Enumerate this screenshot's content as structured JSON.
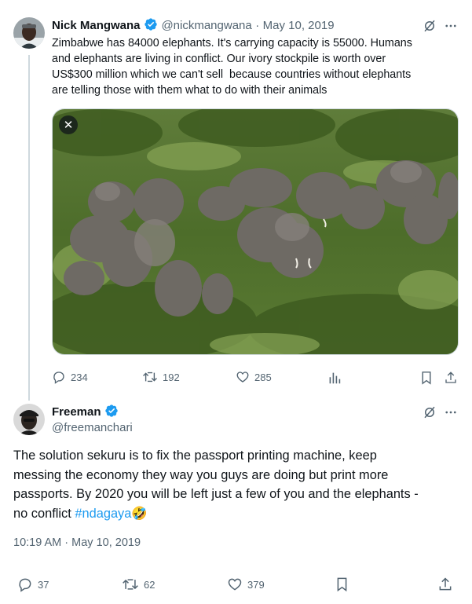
{
  "tweet1": {
    "name": "Nick Mangwana",
    "handle": "@nickmangwana",
    "separator": "·",
    "date": "May 10, 2019",
    "text_lines": [
      "Zimbabwe has 84000 elephants. It's carrying capacity is 55000. Humans",
      "and elephants are living in conflict. Our ivory stockpile is worth over",
      "US$300 million which we can't sell  because countries without elephants",
      "are telling those with them what to do with their animals"
    ],
    "media_close": "✕",
    "replies": "234",
    "retweets": "192",
    "likes": "285"
  },
  "tweet2": {
    "name": "Freeman",
    "handle": "@freemanchari",
    "text_lines": [
      "The solution sekuru is to fix the passport printing machine, keep",
      "messing the economy they way you guys are doing but print more",
      "passports. By 2020 you will be left just a few of you and the elephants -"
    ],
    "last_line_prefix": "no conflict ",
    "hashtag": "#ndagaya",
    "emoji": "🤣",
    "timestamp": "10:19 AM · May 10, 2019",
    "replies": "37",
    "retweets": "62",
    "likes": "379"
  },
  "icons": {
    "more": "more-icon",
    "grok": "grok-icon",
    "verified": "verified-badge-icon",
    "reply": "reply-icon",
    "retweet": "retweet-icon",
    "like": "like-icon",
    "views": "views-icon",
    "bookmark": "bookmark-icon",
    "share": "share-icon"
  },
  "colors": {
    "accent": "#1d9bf0",
    "muted": "#536471",
    "text": "#0f1419",
    "border": "#cfd9de"
  }
}
